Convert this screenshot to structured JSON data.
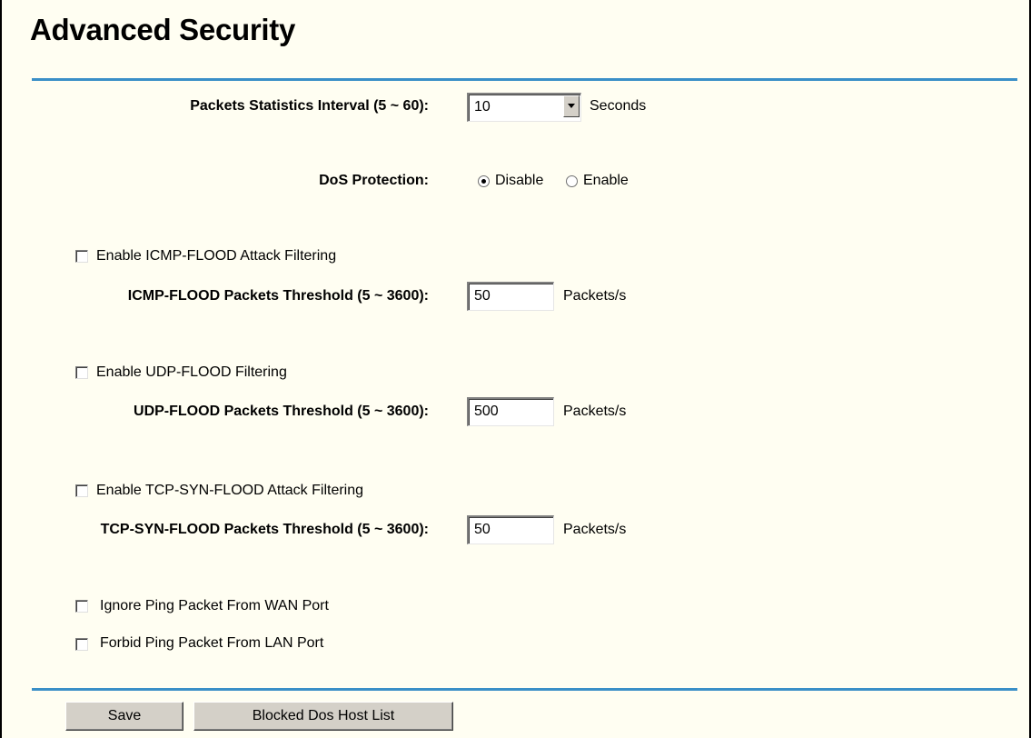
{
  "page": {
    "title": "Advanced Security"
  },
  "interval": {
    "label": "Packets Statistics Interval (5 ~ 60):",
    "value": "10",
    "unit": "Seconds"
  },
  "dos": {
    "label": "DoS Protection:",
    "selected": "Disable",
    "options": [
      "Disable",
      "Enable"
    ]
  },
  "icmp": {
    "enable_label": "Enable ICMP-FLOOD Attack Filtering",
    "enabled": false,
    "threshold_label": "ICMP-FLOOD Packets Threshold (5 ~ 3600):",
    "threshold": "50",
    "unit": "Packets/s"
  },
  "udp": {
    "enable_label": "Enable UDP-FLOOD Filtering",
    "enabled": false,
    "threshold_label": "UDP-FLOOD Packets Threshold (5 ~ 3600):",
    "threshold": "500",
    "unit": "Packets/s"
  },
  "tcp": {
    "enable_label": "Enable TCP-SYN-FLOOD Attack Filtering",
    "enabled": false,
    "threshold_label": "TCP-SYN-FLOOD Packets Threshold (5 ~ 3600):",
    "threshold": "50",
    "unit": "Packets/s"
  },
  "ping": {
    "ignore_wan_label": "Ignore Ping Packet From WAN Port",
    "ignore_wan": false,
    "forbid_lan_label": "Forbid Ping Packet From LAN Port",
    "forbid_lan": false
  },
  "buttons": {
    "save": "Save",
    "blocked_list": "Blocked Dos Host List"
  },
  "colors": {
    "background": "#fffef2",
    "rule": "#3a8fc7",
    "button_face": "#d4d0c8"
  }
}
